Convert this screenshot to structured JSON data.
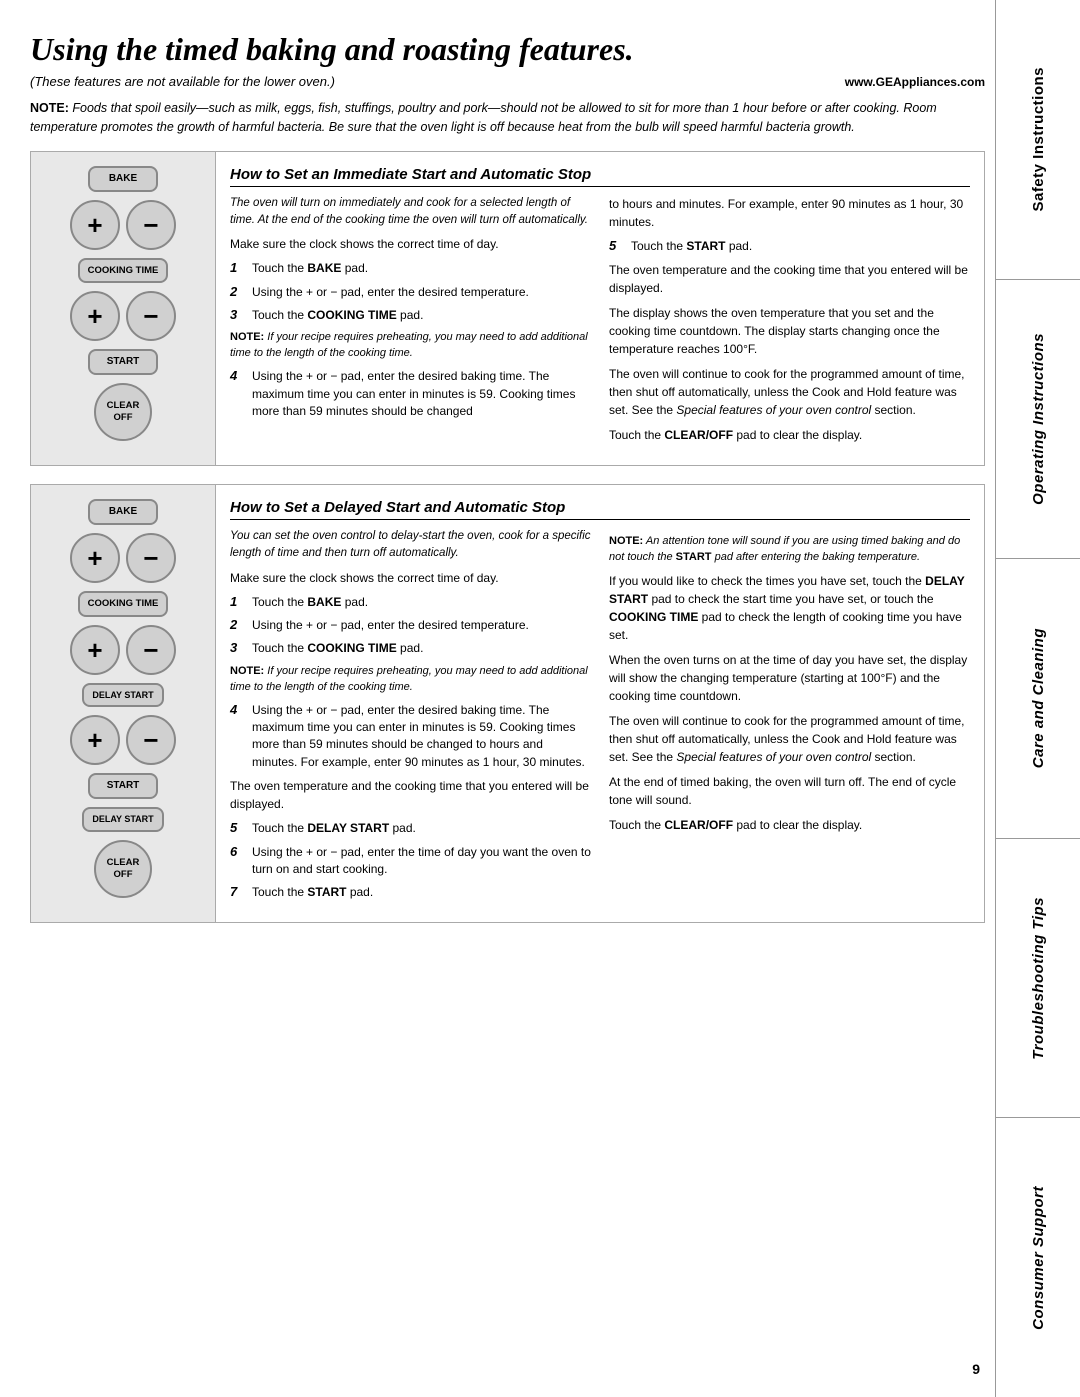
{
  "page": {
    "title": "Using the timed baking and roasting features.",
    "subtitle": "(These features are not available for the lower oven.)",
    "website": "www.GEAppliances.com",
    "note": {
      "prefix": "NOTE:",
      "text": " Foods that spoil easily—such as milk, eggs, fish, stuffings, poultry and pork—should not be allowed to sit for more than 1 hour before or after cooking. Room temperature promotes the growth of harmful bacteria. Be sure that the oven light is off because heat from the bulb will speed harmful bacteria growth."
    },
    "page_number": "9"
  },
  "sidebar": {
    "sections": [
      {
        "id": "safety",
        "label": "Safety Instructions"
      },
      {
        "id": "operating",
        "label": "Operating Instructions"
      },
      {
        "id": "care",
        "label": "Care and Cleaning"
      },
      {
        "id": "troubleshooting",
        "label": "Troubleshooting Tips"
      },
      {
        "id": "consumer",
        "label": "Consumer Support"
      }
    ]
  },
  "section1": {
    "heading": "How to Set an Immediate Start and Automatic Stop",
    "controls": {
      "bake_label": "BAKE",
      "cooking_time_label": "COOKING TIME",
      "start_label": "START",
      "clear_off_label": "CLEAR OFF",
      "plus": "+",
      "minus": "−"
    },
    "left_col": {
      "intro_italic": "The oven will turn on immediately and cook for a selected length of time. At the end of the cooking time the oven will turn off automatically.",
      "step0": "Make sure the clock shows the correct time of day.",
      "steps": [
        {
          "num": "1",
          "text": "Touch the ",
          "bold": "BAKE",
          "rest": " pad."
        },
        {
          "num": "2",
          "text": "Using the + or − pad, enter the desired temperature."
        },
        {
          "num": "3",
          "text": "Touch the ",
          "bold": "COOKING TIME",
          "rest": " pad."
        }
      ],
      "note": {
        "prefix": "NOTE:",
        "text": " If your recipe requires preheating, you may need to add additional time to the length of the cooking time."
      },
      "step4": "Using the + or − pad, enter the desired baking time. The maximum time you can enter in minutes is 59. Cooking times more than 59 minutes should be changed"
    },
    "right_col": {
      "step4_cont": "to hours and minutes. For example, enter 90 minutes as 1 hour, 30 minutes.",
      "step5": {
        "num": "5",
        "text": "Touch the ",
        "bold": "START",
        "rest": " pad."
      },
      "text1": "The oven temperature and the cooking time that you entered will be displayed.",
      "text2": "The display shows the oven temperature that you set and the cooking time countdown. The display starts changing once the temperature reaches 100°F.",
      "text3": "The oven will continue to cook for the programmed amount of time, then shut off automatically, unless the Cook and Hold feature was set. See the ",
      "text3_italic": "Special features of your oven control",
      "text3_end": " section.",
      "text4": "Touch the ",
      "text4_bold": "CLEAR/OFF",
      "text4_end": " pad to clear the display."
    }
  },
  "section2": {
    "heading": "How to Set a Delayed Start and Automatic Stop",
    "controls": {
      "bake_label": "BAKE",
      "cooking_time_label": "COOKING TIME",
      "delay_start_label": "DELAY START",
      "start_label": "START",
      "clear_off_label": "CLEAR OFF",
      "plus": "+",
      "minus": "−"
    },
    "left_col": {
      "intro_italic": "You can set the oven control to delay-start the oven, cook for a specific length of time and then turn off automatically.",
      "step0": "Make sure the clock shows the correct time of day.",
      "steps": [
        {
          "num": "1",
          "text": "Touch the ",
          "bold": "BAKE",
          "rest": " pad."
        },
        {
          "num": "2",
          "text": "Using the + or − pad, enter the desired temperature."
        },
        {
          "num": "3",
          "text": "Touch the ",
          "bold": "COOKING TIME",
          "rest": " pad."
        }
      ],
      "note": {
        "prefix": "NOTE:",
        "text": " If your recipe requires preheating, you may need to add additional time to the length of the cooking time."
      },
      "step4": "Using the + or − pad, enter the desired baking time. The maximum time you can enter in minutes is 59. Cooking times more than 59 minutes should be changed to hours and minutes. For example, enter 90 minutes as 1 hour, 30 minutes.",
      "text_after4": "The oven temperature and the cooking time that you entered will be displayed.",
      "step5": {
        "num": "5",
        "text": "Touch the ",
        "bold": "DELAY START",
        "rest": " pad."
      },
      "step6": {
        "num": "6",
        "text": "Using the + or − pad, enter the time of day you want the oven to turn on and start cooking."
      },
      "step7": {
        "num": "7",
        "text": "Touch the ",
        "bold": "START",
        "rest": " pad."
      }
    },
    "right_col": {
      "note": {
        "prefix": "NOTE:",
        "text": " An attention tone will sound if you are using timed baking and do not touch the ",
        "bold": "START",
        "end": " pad after entering the baking temperature."
      },
      "text1": "If you would like to check the times you have set, touch the ",
      "text1_bold": "DELAY START",
      "text1_mid": " pad to check the start time you have set, or touch the ",
      "text1_bold2": "COOKING TIME",
      "text1_end": " pad to check the length of cooking time you have set.",
      "text2": "When the oven turns on at the time of day you have set, the display will show the changing temperature (starting at 100°F) and the cooking time countdown.",
      "text3": "The oven will continue to cook for the programmed amount of time, then shut off automatically, unless the Cook and Hold feature was set. See the ",
      "text3_italic": "Special features of your oven control",
      "text3_end": " section.",
      "text4": "At the end of timed baking, the oven will turn off. The end of cycle tone will sound.",
      "text5": "Touch the ",
      "text5_bold": "CLEAR/OFF",
      "text5_end": " pad to clear the display."
    }
  }
}
